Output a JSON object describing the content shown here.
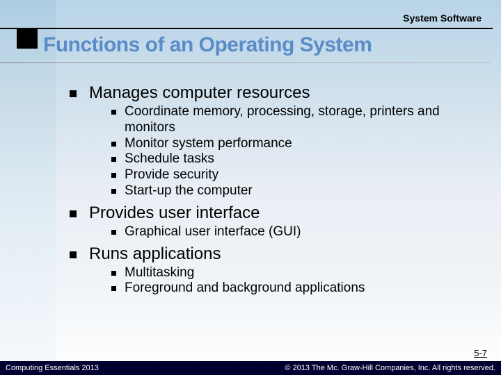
{
  "header": {
    "label": "System Software"
  },
  "title": "Functions of an Operating System",
  "content": {
    "items": [
      {
        "text": "Manages computer resources",
        "sub": [
          "Coordinate memory, processing, storage, printers and monitors",
          "Monitor system performance",
          "Schedule tasks",
          "Provide security",
          "Start-up the computer"
        ]
      },
      {
        "text": "Provides user interface",
        "sub": [
          "Graphical user interface (GUI)"
        ]
      },
      {
        "text": "Runs applications",
        "sub": [
          "Multitasking",
          "Foreground and background applications"
        ]
      }
    ]
  },
  "page_number": "5-7",
  "footer": {
    "left": "Computing Essentials 2013",
    "right": "© 2013 The Mc. Graw-Hill Companies, Inc. All rights reserved."
  }
}
